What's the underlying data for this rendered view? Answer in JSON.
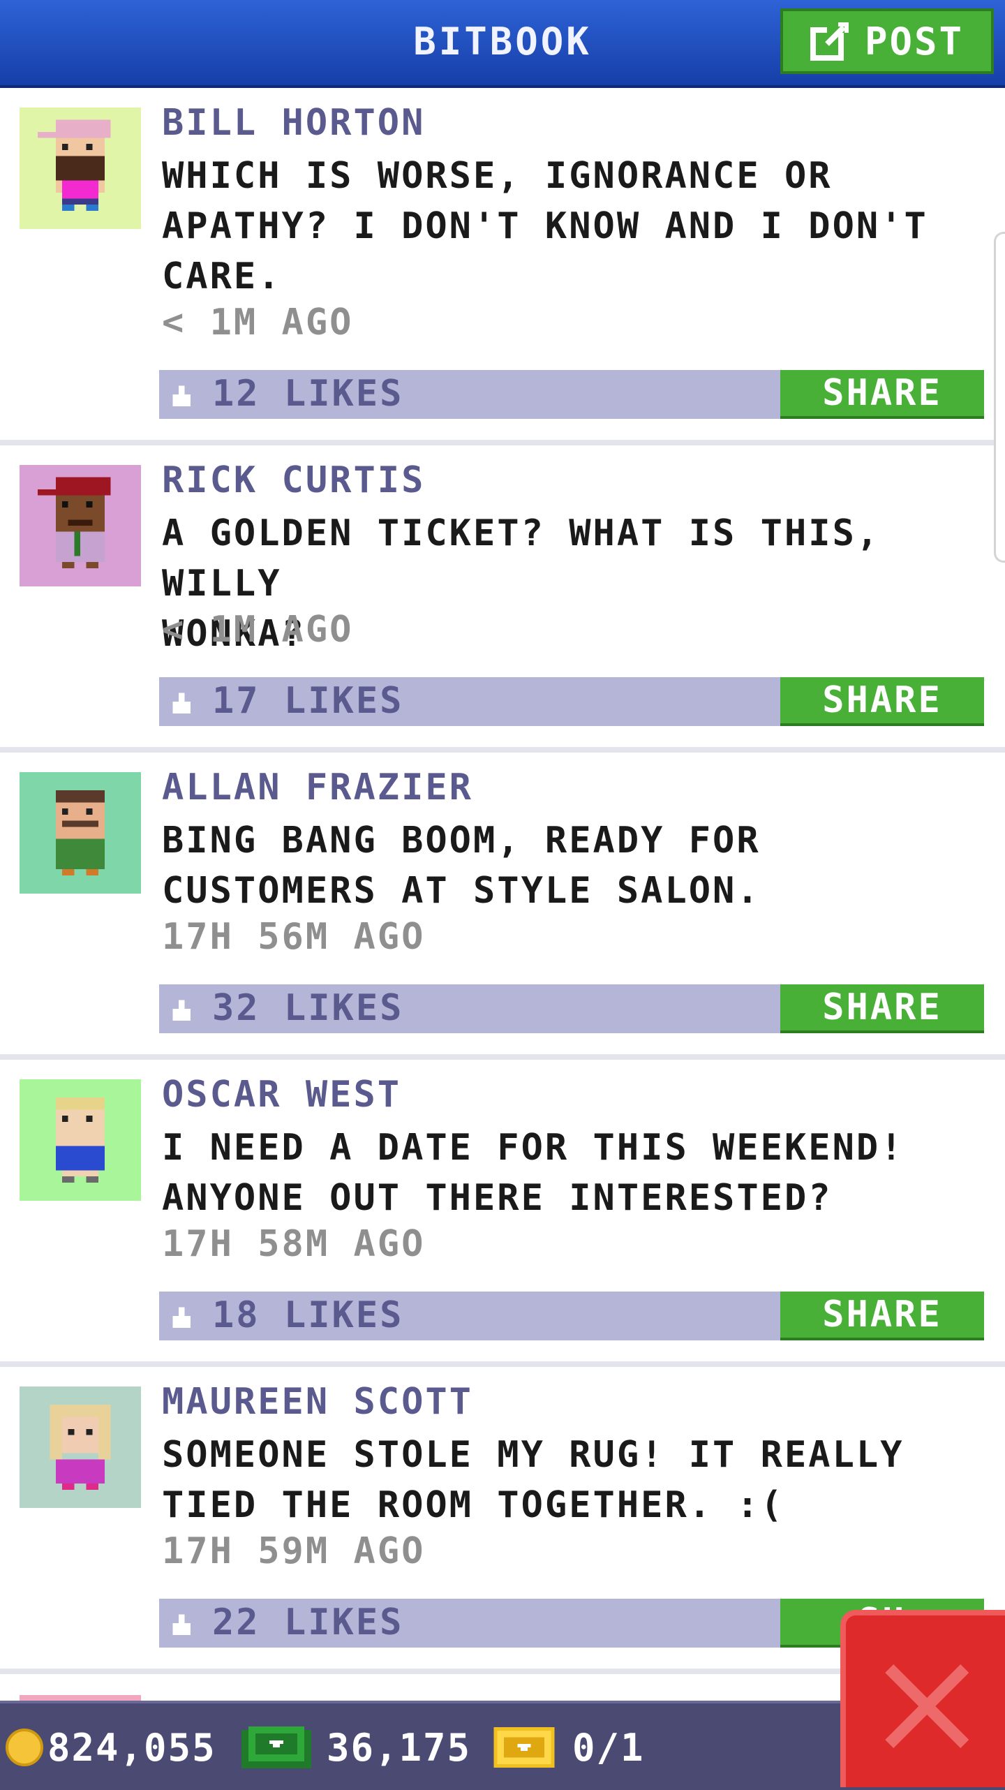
{
  "header": {
    "title": "BITBOOK",
    "post_label": "POST"
  },
  "posts": [
    {
      "author": "BILL HORTON",
      "message": "WHICH IS WORSE, IGNORANCE OR\nAPATHY? I DON'T KNOW AND I DON'T\nCARE.",
      "time": "< 1M AGO",
      "likes": "12 LIKES",
      "share_label": "SHARE",
      "avatar_bg": "#e0f5a8"
    },
    {
      "author": "RICK CURTIS",
      "message": "A GOLDEN TICKET? WHAT IS THIS, WILLY\nWONKA?",
      "time": "< 1M AGO",
      "likes": "17 LIKES",
      "share_label": "SHARE",
      "avatar_bg": "#d9a0d6"
    },
    {
      "author": "ALLAN FRAZIER",
      "message": "BING BANG BOOM, READY FOR\nCUSTOMERS AT STYLE SALON.",
      "time": "17H 56M AGO",
      "likes": "32 LIKES",
      "share_label": "SHARE",
      "avatar_bg": "#7fd6a8"
    },
    {
      "author": "OSCAR WEST",
      "message": "I NEED A DATE FOR THIS WEEKEND!\nANYONE OUT THERE INTERESTED?",
      "time": "17H 58M AGO",
      "likes": "18 LIKES",
      "share_label": "SHARE",
      "avatar_bg": "#a8f59a"
    },
    {
      "author": "MAUREEN SCOTT",
      "message": "SOMEONE STOLE MY RUG! IT REALLY\nTIED THE ROOM TOGETHER. :(",
      "time": "17H 59M AGO",
      "likes": "22 LIKES",
      "share_label": "SH",
      "avatar_bg": "#b3d4c6"
    }
  ],
  "footer": {
    "coins": "824,055",
    "bux": "36,175",
    "tickets": "0/1"
  },
  "colors": {
    "header_blue": "#2e62d6",
    "share_green": "#48b036",
    "like_bar": "#b5b5d8",
    "footer_bg": "#4b4a73",
    "close_red": "#de2a2a"
  }
}
